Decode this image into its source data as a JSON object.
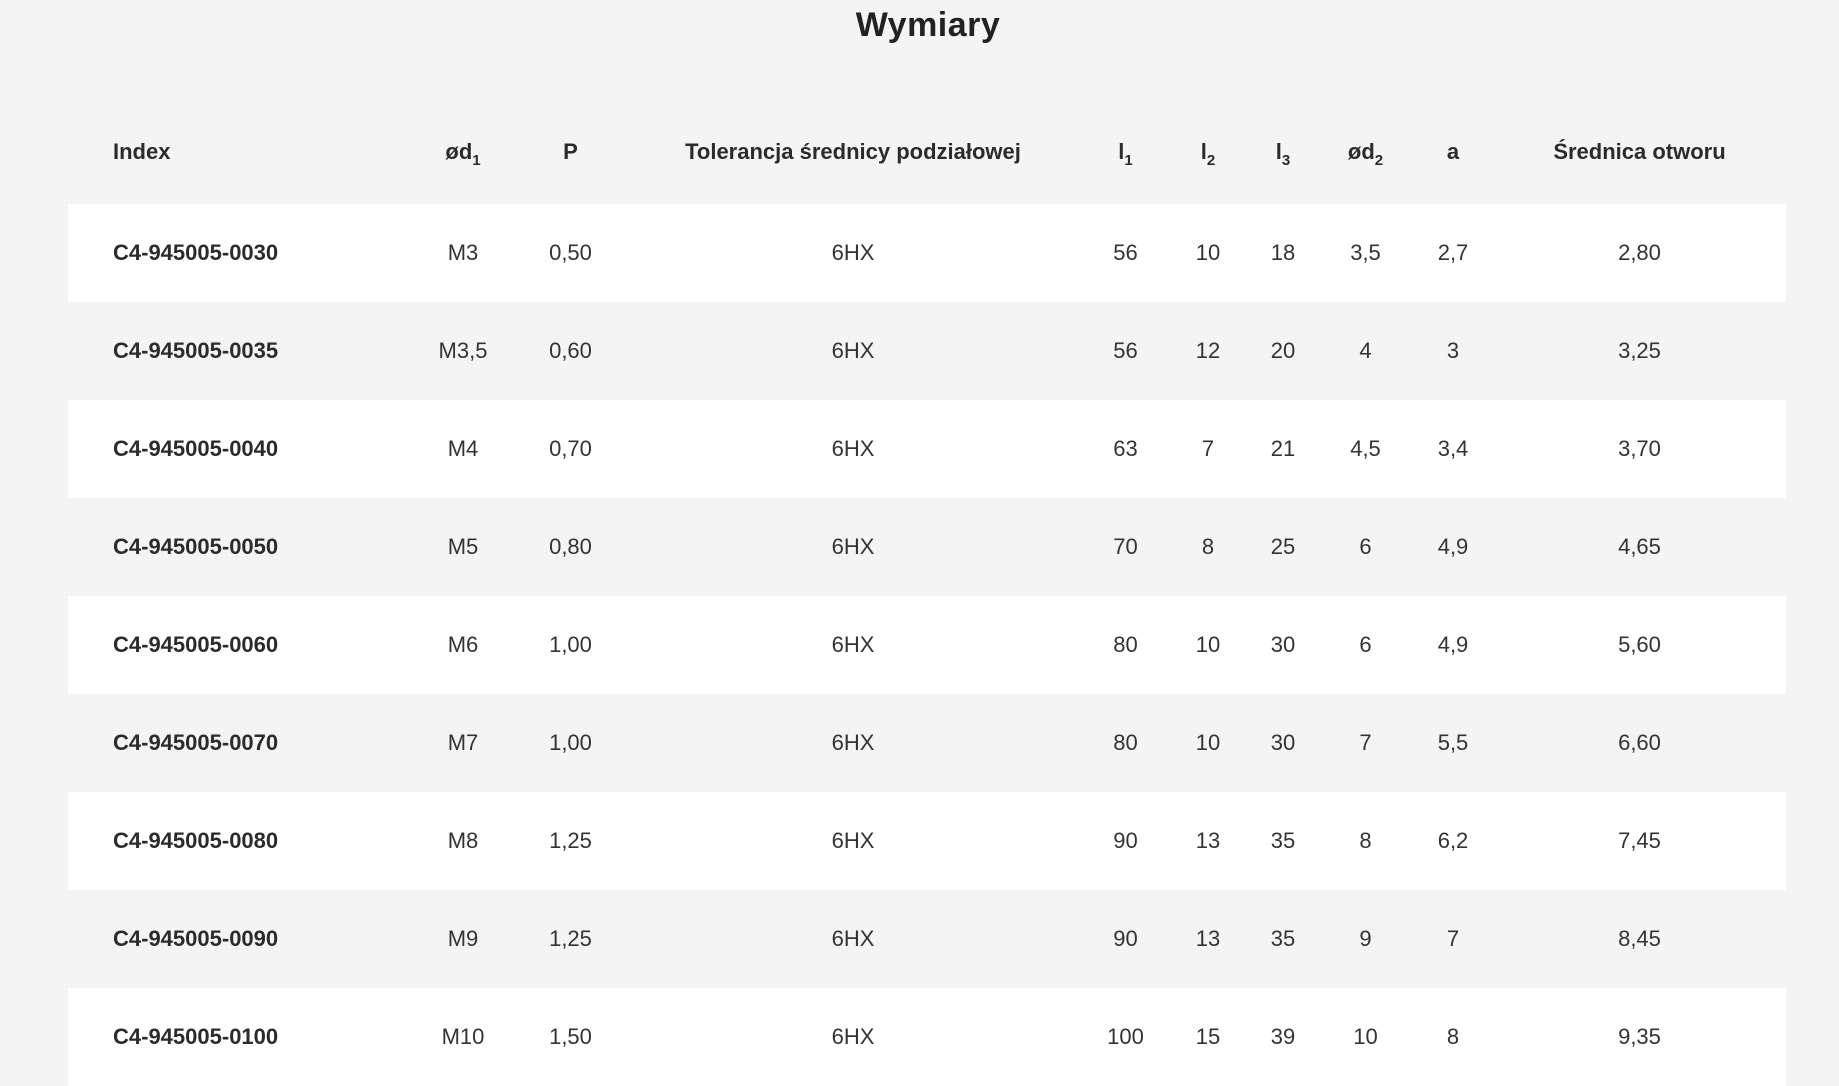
{
  "title": "Wymiary",
  "columns": {
    "index": "Index",
    "d1": {
      "base": "ød",
      "sub": "1"
    },
    "p": "P",
    "tol": "Tolerancja średnicy podziałowej",
    "l1": {
      "base": "l",
      "sub": "1"
    },
    "l2": {
      "base": "l",
      "sub": "2"
    },
    "l3": {
      "base": "l",
      "sub": "3"
    },
    "d2": {
      "base": "ød",
      "sub": "2"
    },
    "a": "a",
    "hole": "Średnica otworu"
  },
  "rows": [
    [
      "C4-945005-0030",
      "M3",
      "0,50",
      "6HX",
      "56",
      "10",
      "18",
      "3,5",
      "2,7",
      "2,80"
    ],
    [
      "C4-945005-0035",
      "M3,5",
      "0,60",
      "6HX",
      "56",
      "12",
      "20",
      "4",
      "3",
      "3,25"
    ],
    [
      "C4-945005-0040",
      "M4",
      "0,70",
      "6HX",
      "63",
      "7",
      "21",
      "4,5",
      "3,4",
      "3,70"
    ],
    [
      "C4-945005-0050",
      "M5",
      "0,80",
      "6HX",
      "70",
      "8",
      "25",
      "6",
      "4,9",
      "4,65"
    ],
    [
      "C4-945005-0060",
      "M6",
      "1,00",
      "6HX",
      "80",
      "10",
      "30",
      "6",
      "4,9",
      "5,60"
    ],
    [
      "C4-945005-0070",
      "M7",
      "1,00",
      "6HX",
      "80",
      "10",
      "30",
      "7",
      "5,5",
      "6,60"
    ],
    [
      "C4-945005-0080",
      "M8",
      "1,25",
      "6HX",
      "90",
      "13",
      "35",
      "8",
      "6,2",
      "7,45"
    ],
    [
      "C4-945005-0090",
      "M9",
      "1,25",
      "6HX",
      "90",
      "13",
      "35",
      "9",
      "7",
      "8,45"
    ],
    [
      "C4-945005-0100",
      "M10",
      "1,50",
      "6HX",
      "100",
      "15",
      "39",
      "10",
      "8",
      "9,35"
    ]
  ]
}
